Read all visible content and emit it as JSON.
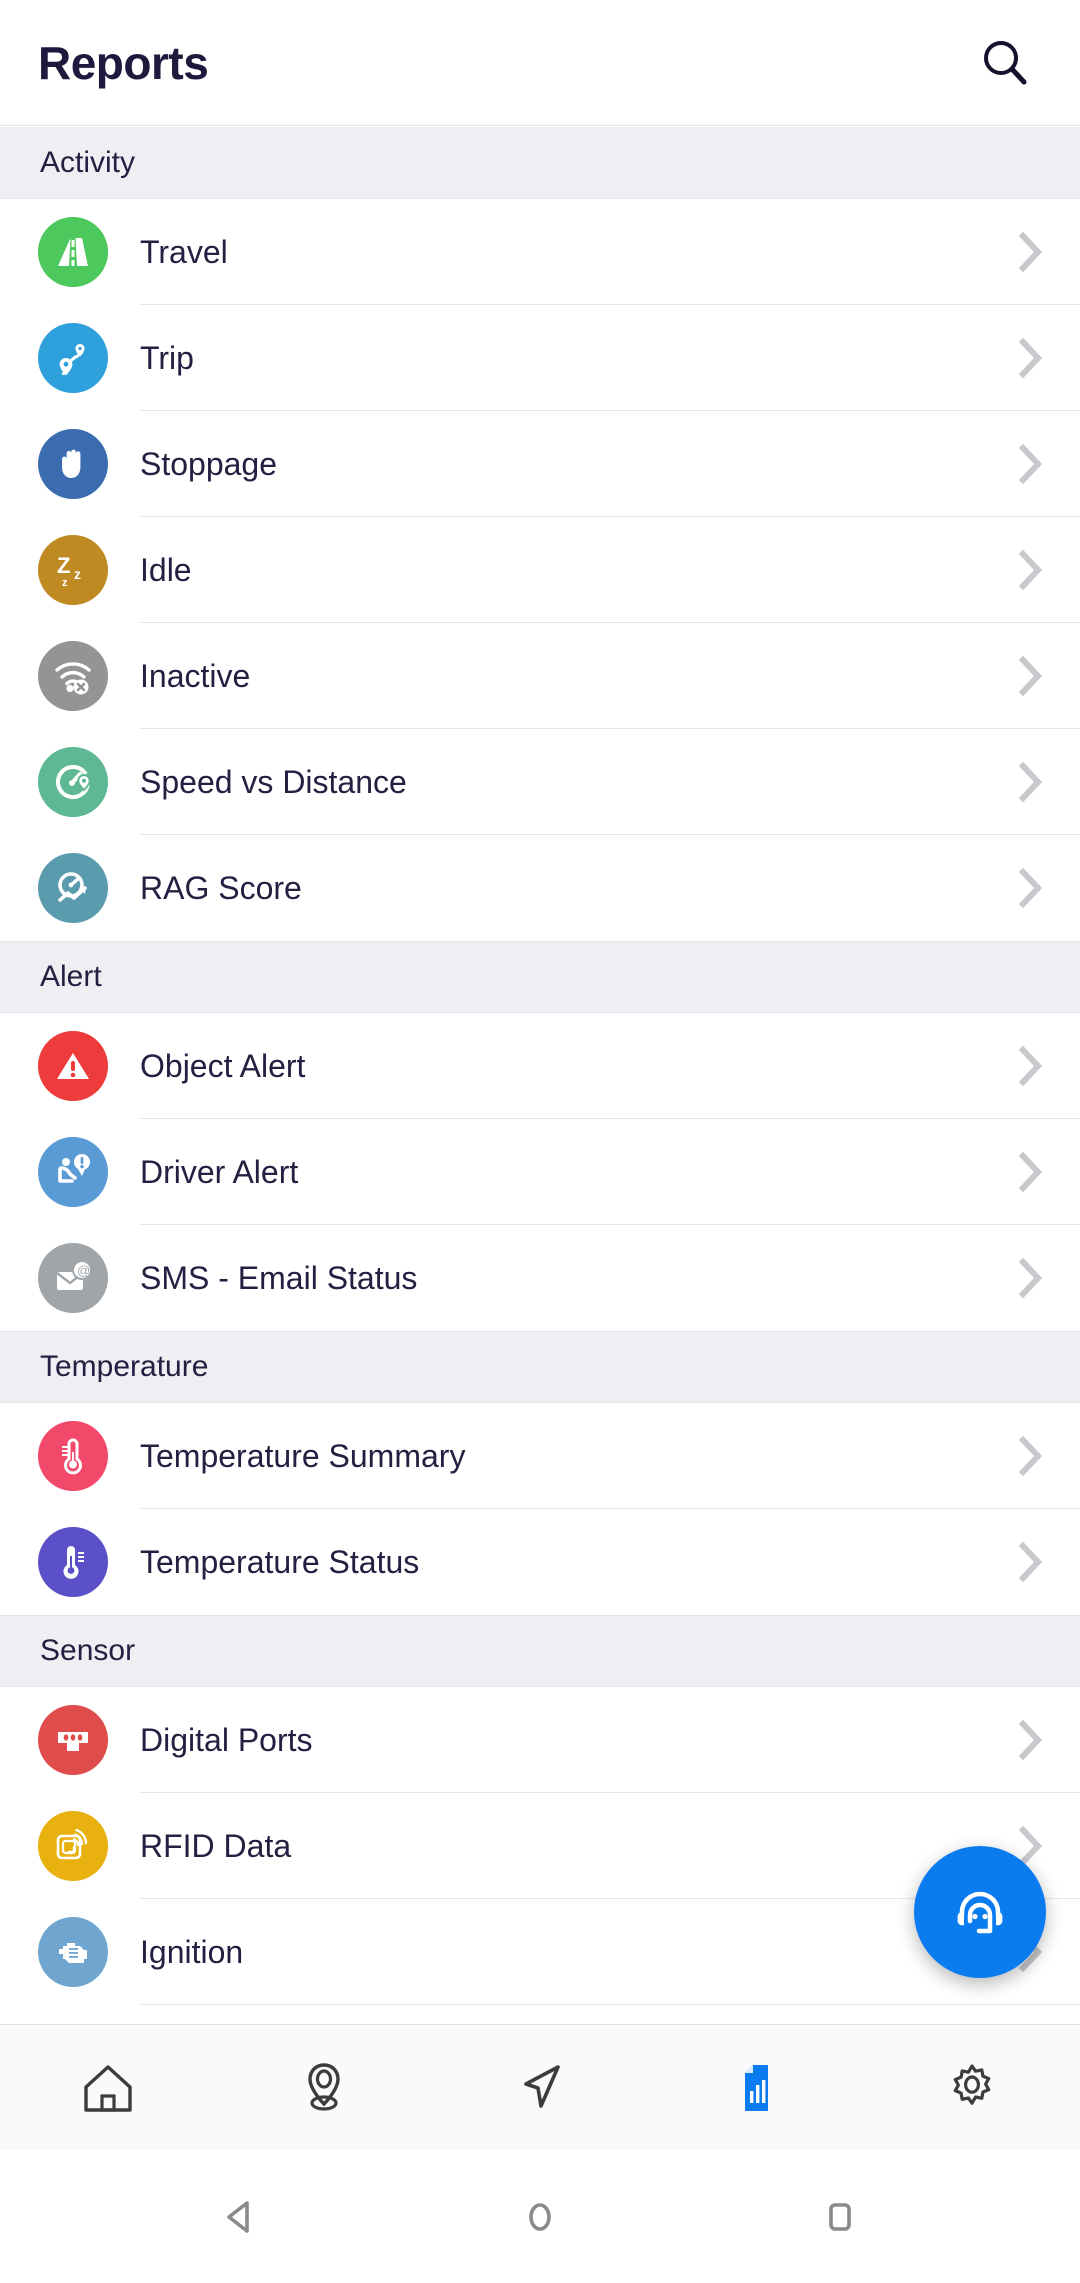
{
  "header": {
    "title": "Reports",
    "search_icon": "search-icon"
  },
  "sections": [
    {
      "title": "Activity",
      "items": [
        {
          "label": "Travel",
          "icon": "road-icon",
          "color": "#4CC85C"
        },
        {
          "label": "Trip",
          "icon": "route-pin-icon",
          "color": "#2EA0DC"
        },
        {
          "label": "Stoppage",
          "icon": "hand-stop-icon",
          "color": "#3B6CB0"
        },
        {
          "label": "Idle",
          "icon": "sleep-zzz-icon",
          "color": "#C08A22"
        },
        {
          "label": "Inactive",
          "icon": "wifi-off-icon",
          "color": "#949494"
        },
        {
          "label": "Speed vs Distance",
          "icon": "speed-pin-icon",
          "color": "#5EB894"
        },
        {
          "label": "RAG Score",
          "icon": "gauge-chart-icon",
          "color": "#5A9BAE"
        }
      ]
    },
    {
      "title": "Alert",
      "items": [
        {
          "label": "Object Alert",
          "icon": "warning-triangle-icon",
          "color": "#EE3B3B"
        },
        {
          "label": "Driver Alert",
          "icon": "driver-alert-icon",
          "color": "#5B9BD5"
        },
        {
          "label": "SMS - Email Status",
          "icon": "mail-at-icon",
          "color": "#A0A5AA"
        }
      ]
    },
    {
      "title": "Temperature",
      "items": [
        {
          "label": "Temperature Summary",
          "icon": "thermometer-icon",
          "color": "#F2496B"
        },
        {
          "label": "Temperature Status",
          "icon": "thermometer-alt-icon",
          "color": "#5B50C8"
        }
      ]
    },
    {
      "title": "Sensor",
      "items": [
        {
          "label": "Digital Ports",
          "icon": "port-connector-icon",
          "color": "#E04B4B"
        },
        {
          "label": "RFID Data",
          "icon": "rfid-icon",
          "color": "#E8B110"
        },
        {
          "label": "Ignition",
          "icon": "engine-icon",
          "color": "#6FA5CE"
        }
      ]
    }
  ],
  "fab": {
    "icon": "support-headset-icon",
    "color": "#0b7bf0"
  },
  "tabbar": {
    "active_color": "#0b7bf0",
    "inactive_color": "#3c3c3c",
    "items": [
      {
        "name": "home",
        "icon": "home-icon",
        "active": false
      },
      {
        "name": "location",
        "icon": "map-pin-icon",
        "active": false
      },
      {
        "name": "track",
        "icon": "navigation-icon",
        "active": false
      },
      {
        "name": "reports",
        "icon": "report-icon",
        "active": true
      },
      {
        "name": "settings",
        "icon": "gear-icon",
        "active": false
      }
    ]
  },
  "system_nav": {
    "items": [
      {
        "name": "back",
        "icon": "back-triangle-icon"
      },
      {
        "name": "home",
        "icon": "home-circle-icon"
      },
      {
        "name": "recents",
        "icon": "recents-square-icon"
      }
    ]
  },
  "chevron_color": "#c9c9cd"
}
